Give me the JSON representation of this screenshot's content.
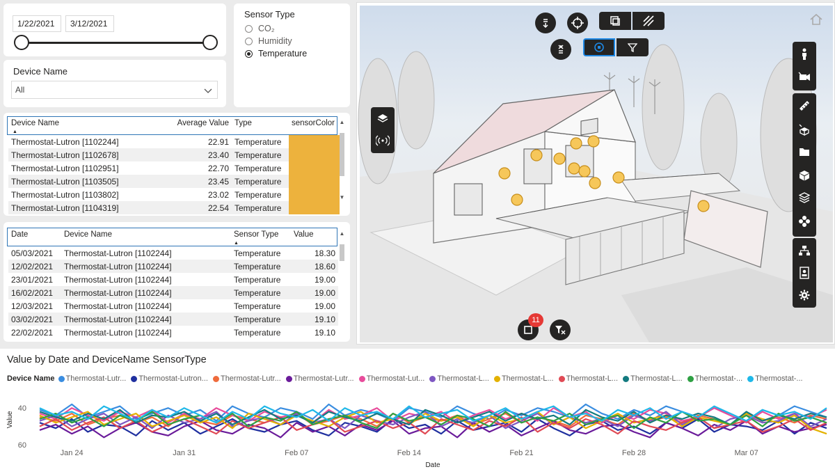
{
  "date_slicer": {
    "start": "1/22/2021",
    "end": "3/12/2021"
  },
  "device_slicer": {
    "title": "Device Name",
    "value": "All"
  },
  "sensor_slicer": {
    "title": "Sensor Type",
    "options": [
      {
        "label": "CO₂",
        "selected": false
      },
      {
        "label": "Humidity",
        "selected": false
      },
      {
        "label": "Temperature",
        "selected": true
      }
    ]
  },
  "summary_table": {
    "headers": [
      "Device Name",
      "Average Value",
      "Type",
      "sensorColor"
    ],
    "rows": [
      {
        "device": "Thermostat-Lutron [1102244]",
        "avg": "22.91",
        "type": "Temperature"
      },
      {
        "device": "Thermostat-Lutron [1102678]",
        "avg": "23.40",
        "type": "Temperature"
      },
      {
        "device": "Thermostat-Lutron [1102951]",
        "avg": "22.70",
        "type": "Temperature"
      },
      {
        "device": "Thermostat-Lutron [1103505]",
        "avg": "23.45",
        "type": "Temperature"
      },
      {
        "device": "Thermostat-Lutron [1103802]",
        "avg": "23.02",
        "type": "Temperature"
      },
      {
        "device": "Thermostat-Lutron [1104319]",
        "avg": "22.54",
        "type": "Temperature"
      }
    ],
    "color_swatch": "#edb23d"
  },
  "detail_table": {
    "headers": [
      "Date",
      "Device Name",
      "Sensor Type",
      "Value"
    ],
    "rows": [
      {
        "date": "05/03/2021",
        "device": "Thermostat-Lutron [1102244]",
        "type": "Temperature",
        "value": "18.30"
      },
      {
        "date": "12/02/2021",
        "device": "Thermostat-Lutron [1102244]",
        "type": "Temperature",
        "value": "18.60"
      },
      {
        "date": "23/01/2021",
        "device": "Thermostat-Lutron [1102244]",
        "type": "Temperature",
        "value": "19.00"
      },
      {
        "date": "16/02/2021",
        "device": "Thermostat-Lutron [1102244]",
        "type": "Temperature",
        "value": "19.00"
      },
      {
        "date": "12/03/2021",
        "device": "Thermostat-Lutron [1102244]",
        "type": "Temperature",
        "value": "19.00"
      },
      {
        "date": "03/02/2021",
        "device": "Thermostat-Lutron [1102244]",
        "type": "Temperature",
        "value": "19.10"
      },
      {
        "date": "22/02/2021",
        "device": "Thermostat-Lutron [1102244]",
        "type": "Temperature",
        "value": "19.10"
      }
    ]
  },
  "viewer": {
    "selection_badge": "11",
    "toolbar_icons": [
      "floor-down-icon",
      "target-icon",
      "section-box-icon",
      "hatch-icon",
      "floor-up-icon",
      "isolate-icon",
      "filter-icon"
    ],
    "left_icons": [
      "layers-icon",
      "sensor-signal-icon"
    ],
    "right_icons": [
      "person-icon",
      "camera-icon",
      "measure-icon",
      "explode-icon",
      "folder-icon",
      "cube-icon",
      "stack-icon",
      "model-tree-icon",
      "hierarchy-icon",
      "properties-icon",
      "settings-icon"
    ],
    "accent": "#1e88e5",
    "sensor_marker_color": "#f6c75a"
  },
  "line_chart": {
    "title": "Value by Date and DeviceName SensorType",
    "legend_title": "Device Name",
    "legend": [
      {
        "label": "Thermostat-Lutr...",
        "color": "#3a8de0"
      },
      {
        "label": "Thermostat-Lutron...",
        "color": "#1f2f9f"
      },
      {
        "label": "Thermostat-Lutr...",
        "color": "#ef6b3c"
      },
      {
        "label": "Thermostat-Lutr...",
        "color": "#6a1b9a"
      },
      {
        "label": "Thermostat-Lut...",
        "color": "#e84c9b"
      },
      {
        "label": "Thermostat-L...",
        "color": "#7e57c2"
      },
      {
        "label": "Thermostat-L...",
        "color": "#e3b100"
      },
      {
        "label": "Thermostat-L...",
        "color": "#e04a55"
      },
      {
        "label": "Thermostat-L...",
        "color": "#137a7f"
      },
      {
        "label": "Thermostat-...",
        "color": "#2ea043"
      },
      {
        "label": "Thermostat-...",
        "color": "#1fb8e8"
      }
    ]
  },
  "chart_data": {
    "type": "line",
    "title": "Value by Date and DeviceName SensorType",
    "xlabel": "Date",
    "ylabel": "Value",
    "y_ticks": [
      "40",
      "60"
    ],
    "x_ticks": [
      "Jan 24",
      "Jan 31",
      "Feb 07",
      "Feb 14",
      "Feb 21",
      "Feb 28",
      "Mar 07"
    ],
    "x_range": [
      "2021-01-22",
      "2021-03-12"
    ],
    "series_colors": [
      "#3a8de0",
      "#1f2f9f",
      "#ef6b3c",
      "#6a1b9a",
      "#e84c9b",
      "#7e57c2",
      "#e3b100",
      "#e04a55",
      "#137a7f",
      "#2ea043",
      "#1fb8e8"
    ],
    "series": [
      {
        "values": [
          41,
          44,
          38,
          45,
          42,
          39,
          46,
          43,
          40,
          44,
          41,
          47,
          39,
          43,
          45,
          40,
          42,
          46,
          38,
          44,
          41,
          43,
          47,
          40,
          42,
          45,
          39,
          43,
          46,
          41,
          44,
          40,
          42,
          45,
          38,
          43,
          46,
          41,
          44,
          39,
          42,
          45,
          40,
          43,
          47,
          41,
          44,
          39,
          42,
          45
        ]
      },
      {
        "values": [
          48,
          51,
          46,
          53,
          49,
          50,
          55,
          47,
          52,
          48,
          54,
          50,
          46,
          51,
          53,
          49,
          47,
          52,
          55,
          48,
          50,
          53,
          46,
          51,
          49,
          54,
          47,
          52,
          50,
          48,
          53,
          46,
          51,
          55,
          49,
          47,
          52,
          50,
          54,
          48,
          51,
          46,
          53,
          49,
          50,
          52,
          47,
          54,
          48,
          51
        ]
      },
      {
        "values": [
          45,
          47,
          43,
          49,
          46,
          44,
          48,
          45,
          50,
          43,
          47,
          49,
          44,
          46,
          48,
          45,
          43,
          49,
          47,
          44,
          46,
          50,
          43,
          48,
          45,
          47,
          44,
          49,
          46,
          43,
          48,
          45,
          47,
          50,
          44,
          46,
          49,
          43,
          47,
          45,
          48,
          44,
          46,
          49,
          43,
          47,
          45,
          48,
          44,
          46
        ]
      },
      {
        "values": [
          52,
          49,
          54,
          50,
          56,
          51,
          48,
          53,
          55,
          50,
          47,
          52,
          54,
          49,
          51,
          56,
          48,
          53,
          50,
          55,
          49,
          52,
          47,
          54,
          51,
          50,
          56,
          48,
          53,
          49,
          55,
          51,
          47,
          52,
          54,
          50,
          49,
          53,
          56,
          48,
          51,
          55,
          49,
          52,
          47,
          54,
          50,
          53,
          51,
          49
        ]
      },
      {
        "values": [
          43,
          46,
          40,
          44,
          47,
          42,
          45,
          41,
          48,
          43,
          46,
          40,
          44,
          47,
          42,
          45,
          43,
          48,
          41,
          46,
          44,
          40,
          47,
          43,
          45,
          42,
          48,
          44,
          41,
          46,
          43,
          47,
          40,
          45,
          42,
          48,
          44,
          46,
          41,
          43,
          47,
          45,
          40,
          44,
          48,
          42,
          46,
          43,
          45,
          41
        ]
      },
      {
        "values": [
          47,
          44,
          50,
          46,
          43,
          49,
          45,
          51,
          44,
          48,
          46,
          42,
          50,
          47,
          45,
          49,
          43,
          48,
          46,
          51,
          44,
          47,
          49,
          45,
          42,
          50,
          46,
          48,
          44,
          51,
          47,
          43,
          49,
          45,
          48,
          46,
          50,
          44,
          47,
          42,
          49,
          45,
          51,
          46,
          44,
          48,
          47,
          43,
          50,
          46
        ]
      },
      {
        "values": [
          44,
          48,
          45,
          42,
          49,
          46,
          43,
          50,
          47,
          44,
          48,
          45,
          51,
          43,
          46,
          49,
          44,
          47,
          50,
          45,
          42,
          48,
          46,
          49,
          43,
          47,
          45,
          50,
          44,
          48,
          46,
          42,
          49,
          45,
          51,
          47,
          43,
          48,
          46,
          44,
          50,
          45,
          47,
          49,
          43,
          46,
          48,
          44,
          51,
          54
        ]
      },
      {
        "values": [
          50,
          46,
          52,
          48,
          45,
          51,
          47,
          53,
          49,
          46,
          50,
          54,
          47,
          51,
          48,
          45,
          52,
          49,
          46,
          53,
          50,
          47,
          51,
          48,
          54,
          46,
          49,
          52,
          47,
          50,
          45,
          53,
          48,
          51,
          46,
          49,
          54,
          47,
          50,
          52,
          48,
          45,
          51,
          49,
          47,
          53,
          50,
          46,
          52,
          48
        ]
      },
      {
        "values": [
          42,
          45,
          47,
          43,
          46,
          41,
          48,
          44,
          45,
          42,
          47,
          43,
          49,
          45,
          41,
          46,
          44,
          48,
          42,
          45,
          47,
          43,
          46,
          49,
          41,
          44,
          48,
          45,
          42,
          47,
          43,
          46,
          44,
          49,
          41,
          45,
          47,
          42,
          48,
          44,
          46,
          43,
          45,
          49,
          42,
          47,
          44,
          46,
          43,
          45
        ]
      },
      {
        "values": [
          46,
          43,
          48,
          45,
          50,
          44,
          47,
          42,
          49,
          46,
          44,
          48,
          43,
          50,
          45,
          47,
          42,
          49,
          46,
          44,
          48,
          51,
          43,
          47,
          45,
          49,
          44,
          46,
          50,
          42,
          48,
          45,
          47,
          43,
          49,
          46,
          44,
          51,
          45,
          48,
          42,
          47,
          46,
          49,
          44,
          50,
          43,
          47,
          45,
          48
        ]
      },
      {
        "values": [
          40,
          44,
          42,
          46,
          39,
          43,
          47,
          41,
          45,
          40,
          44,
          48,
          42,
          46,
          39,
          43,
          45,
          41,
          47,
          40,
          44,
          42,
          46,
          39,
          45,
          43,
          41,
          47,
          44,
          40,
          46,
          42,
          39,
          45,
          43,
          47,
          41,
          44,
          40,
          46,
          42,
          45,
          39,
          43,
          47,
          41,
          44,
          42,
          46,
          40
        ]
      }
    ]
  }
}
